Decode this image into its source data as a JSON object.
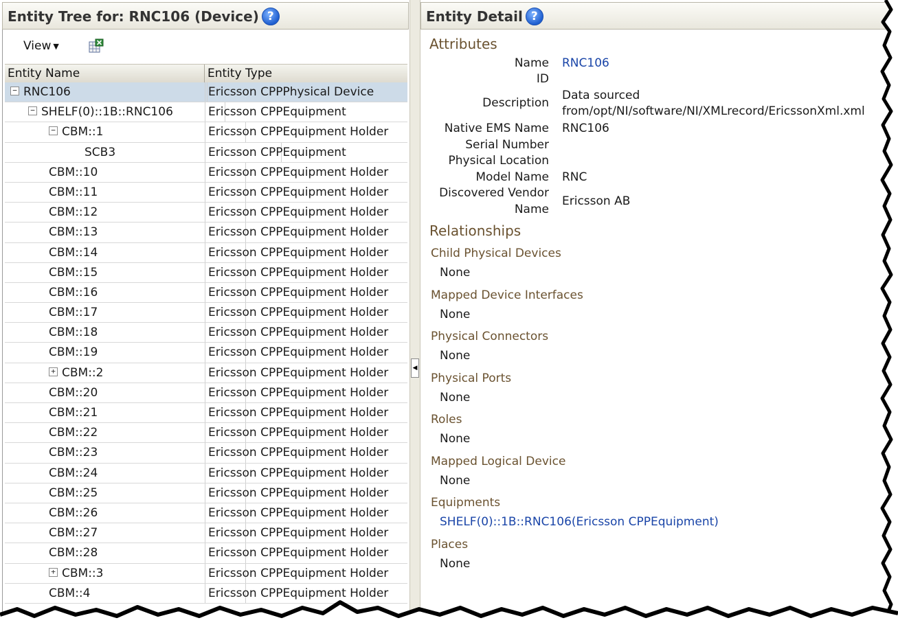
{
  "left_header": {
    "title": "Entity Tree for: RNC106 (Device)",
    "help": "?"
  },
  "right_header": {
    "title": "Entity Detail",
    "help": "?"
  },
  "toolbar": {
    "view_label": "View"
  },
  "tree": {
    "columns": [
      "Entity Name",
      "Entity Type"
    ],
    "rows": [
      {
        "name": "RNC106",
        "type": "Ericsson CPPPhysical Device",
        "toggle": "−",
        "level": 0,
        "selected": true
      },
      {
        "name": "SHELF(0)::1B::RNC106",
        "type": "Ericsson CPPEquipment",
        "toggle": "−",
        "level": 1
      },
      {
        "name": "CBM::1",
        "type": "Ericsson CPPEquipment Holder",
        "toggle": "−",
        "level": 2
      },
      {
        "name": "SCB3",
        "type": "Ericsson CPPEquipment",
        "toggle": "",
        "level": 3
      },
      {
        "name": "CBM::10",
        "type": "Ericsson CPPEquipment Holder",
        "toggle": "",
        "level": 2
      },
      {
        "name": "CBM::11",
        "type": "Ericsson CPPEquipment Holder",
        "toggle": "",
        "level": 2
      },
      {
        "name": "CBM::12",
        "type": "Ericsson CPPEquipment Holder",
        "toggle": "",
        "level": 2
      },
      {
        "name": "CBM::13",
        "type": "Ericsson CPPEquipment Holder",
        "toggle": "",
        "level": 2
      },
      {
        "name": "CBM::14",
        "type": "Ericsson CPPEquipment Holder",
        "toggle": "",
        "level": 2
      },
      {
        "name": "CBM::15",
        "type": "Ericsson CPPEquipment Holder",
        "toggle": "",
        "level": 2
      },
      {
        "name": "CBM::16",
        "type": "Ericsson CPPEquipment Holder",
        "toggle": "",
        "level": 2
      },
      {
        "name": "CBM::17",
        "type": "Ericsson CPPEquipment Holder",
        "toggle": "",
        "level": 2
      },
      {
        "name": "CBM::18",
        "type": "Ericsson CPPEquipment Holder",
        "toggle": "",
        "level": 2
      },
      {
        "name": "CBM::19",
        "type": "Ericsson CPPEquipment Holder",
        "toggle": "",
        "level": 2
      },
      {
        "name": "CBM::2",
        "type": "Ericsson CPPEquipment Holder",
        "toggle": "+",
        "level": 2
      },
      {
        "name": "CBM::20",
        "type": "Ericsson CPPEquipment Holder",
        "toggle": "",
        "level": 2
      },
      {
        "name": "CBM::21",
        "type": "Ericsson CPPEquipment Holder",
        "toggle": "",
        "level": 2
      },
      {
        "name": "CBM::22",
        "type": "Ericsson CPPEquipment Holder",
        "toggle": "",
        "level": 2
      },
      {
        "name": "CBM::23",
        "type": "Ericsson CPPEquipment Holder",
        "toggle": "",
        "level": 2
      },
      {
        "name": "CBM::24",
        "type": "Ericsson CPPEquipment Holder",
        "toggle": "",
        "level": 2
      },
      {
        "name": "CBM::25",
        "type": "Ericsson CPPEquipment Holder",
        "toggle": "",
        "level": 2
      },
      {
        "name": "CBM::26",
        "type": "Ericsson CPPEquipment Holder",
        "toggle": "",
        "level": 2
      },
      {
        "name": "CBM::27",
        "type": "Ericsson CPPEquipment Holder",
        "toggle": "",
        "level": 2
      },
      {
        "name": "CBM::28",
        "type": "Ericsson CPPEquipment Holder",
        "toggle": "",
        "level": 2
      },
      {
        "name": "CBM::3",
        "type": "Ericsson CPPEquipment Holder",
        "toggle": "+",
        "level": 2
      },
      {
        "name": "CBM::4",
        "type": "Ericsson CPPEquipment Holder",
        "toggle": "",
        "level": 2
      }
    ]
  },
  "detail": {
    "attributes_title": "Attributes",
    "attributes": {
      "name_label": "Name",
      "name_value": "RNC106",
      "id_label": "ID",
      "description_label": "Description",
      "description_value_1": "Data sourced",
      "description_value_2": "from/opt/NI/software/NI/XMLrecord/EricssonXml.xml",
      "native_ems_label": "Native EMS Name",
      "native_ems_value": "RNC106",
      "serial_label": "Serial Number",
      "location_label": "Physical Location",
      "model_label": "Model Name",
      "model_value": "RNC",
      "vendor_label_1": "Discovered Vendor",
      "vendor_label_2": "Name",
      "vendor_value": "Ericsson AB"
    },
    "relationships_title": "Relationships",
    "relationships": [
      {
        "title": "Child Physical Devices",
        "value": "None"
      },
      {
        "title": "Mapped Device Interfaces",
        "value": "None"
      },
      {
        "title": "Physical Connectors",
        "value": "None"
      },
      {
        "title": "Physical Ports",
        "value": "None"
      },
      {
        "title": "Roles",
        "value": "None"
      },
      {
        "title": "Mapped Logical Device",
        "value": "None"
      },
      {
        "title": "Equipments",
        "value": "SHELF(0)::1B::RNC106(Ericsson CPPEquipment)",
        "link": true
      },
      {
        "title": "Places",
        "value": "None"
      }
    ]
  }
}
